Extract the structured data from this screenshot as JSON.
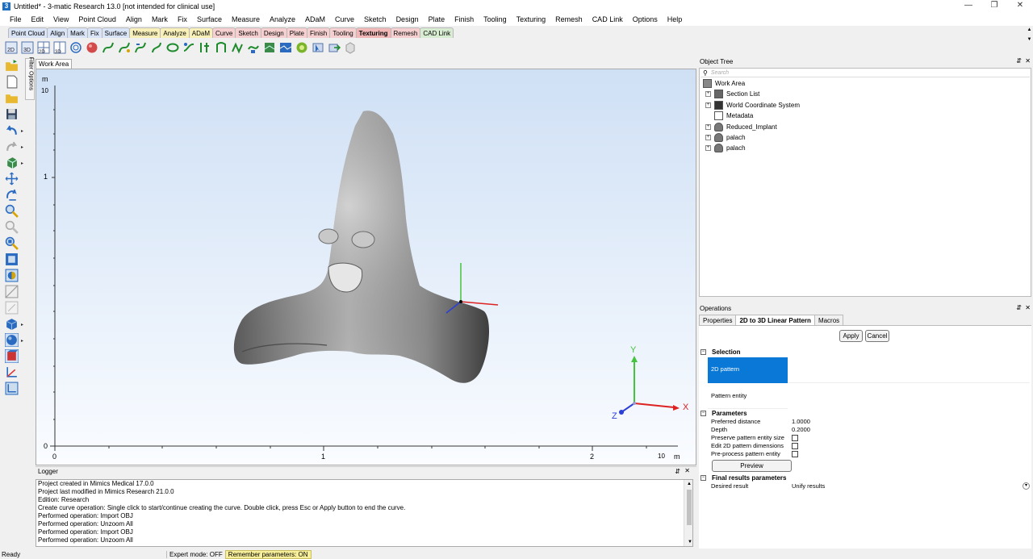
{
  "window": {
    "title": "Untitled* - 3-matic Research 13.0  [not intended for clinical use]",
    "app_icon": "3"
  },
  "menu": [
    "File",
    "Edit",
    "View",
    "Point Cloud",
    "Align",
    "Mark",
    "Fix",
    "Surface",
    "Measure",
    "Analyze",
    "ADaM",
    "Curve",
    "Sketch",
    "Design",
    "Plate",
    "Finish",
    "Tooling",
    "Texturing",
    "Remesh",
    "CAD Link",
    "Options",
    "Help"
  ],
  "tabs": [
    {
      "label": "Point Cloud",
      "color": "#d9e4f7"
    },
    {
      "label": "Align",
      "color": "#d9e4f7"
    },
    {
      "label": "Mark",
      "color": "#d9e4f7"
    },
    {
      "label": "Fix",
      "color": "#d9e4f7"
    },
    {
      "label": "Surface",
      "color": "#d9e4f7"
    },
    {
      "label": "Measure",
      "color": "#f8f0b8"
    },
    {
      "label": "Analyze",
      "color": "#f8f0b8"
    },
    {
      "label": "ADaM",
      "color": "#f8f0b8"
    },
    {
      "label": "Curve",
      "color": "#f6d0d0"
    },
    {
      "label": "Sketch",
      "color": "#f6d0d0"
    },
    {
      "label": "Design",
      "color": "#f6d0d0"
    },
    {
      "label": "Plate",
      "color": "#f6d0d0"
    },
    {
      "label": "Finish",
      "color": "#f6d0d0"
    },
    {
      "label": "Tooling",
      "color": "#f6d0d0"
    },
    {
      "label": "Texturing",
      "color": "#f2b8b8"
    },
    {
      "label": "Remesh",
      "color": "#f6d0d0"
    },
    {
      "label": "CAD Link",
      "color": "#d8ecd2"
    }
  ],
  "viewport": {
    "tab_label": "Work Area",
    "y_unit": "m",
    "y_ticks": [
      "10",
      "1",
      "0"
    ],
    "x_ticks": [
      "0",
      "1",
      "2",
      "10"
    ],
    "x_unit": "m",
    "axis_labels": {
      "x": "X",
      "y": "Y",
      "z": "Z"
    }
  },
  "side_label": "Filter Options",
  "object_tree": {
    "title": "Object Tree",
    "search_placeholder": "Search",
    "items": [
      {
        "label": "Work Area",
        "icon": "work-area-icon"
      },
      {
        "label": "Section List",
        "icon": "section-list-icon"
      },
      {
        "label": "World Coordinate System",
        "icon": "coordinate-system-icon"
      },
      {
        "label": "Metadata",
        "icon": "metadata-icon"
      },
      {
        "label": "Reduced_Implant",
        "icon": "part-icon"
      },
      {
        "label": "palach",
        "icon": "part-icon"
      },
      {
        "label": "palach",
        "icon": "part-icon"
      }
    ]
  },
  "operations": {
    "title": "Operations",
    "tabs": [
      "Properties",
      "2D to 3D Linear Pattern",
      "Macros"
    ],
    "apply": "Apply",
    "cancel": "Cancel",
    "selection": {
      "title": "Selection",
      "pattern_2d": "2D pattern",
      "pattern_entity": "Pattern entity"
    },
    "parameters": {
      "title": "Parameters",
      "preferred_distance_label": "Preferred distance",
      "preferred_distance": "1.0000",
      "depth_label": "Depth",
      "depth": "0.2000",
      "preserve_label": "Preserve pattern entity size",
      "edit_label": "Edit 2D pattern dimensions",
      "preprocess_label": "Pre-process pattern entity",
      "preview": "Preview"
    },
    "final": {
      "title": "Final results parameters",
      "desired_label": "Desired result",
      "desired": "Unify results"
    }
  },
  "logger": {
    "title": "Logger",
    "lines": [
      "Project created in Mimics Medical 17.0.0",
      "Project last modified in Mimics Research 21.0.0",
      "Edition: Research",
      "Create curve operation: Single click to start/continue creating the curve. Double click, press Esc or Apply button to end the curve.",
      "Performed operation: Import OBJ",
      "Performed operation: Unzoom All",
      "Performed operation: Import OBJ",
      "Performed operation: Unzoom All"
    ]
  },
  "status": {
    "ready": "Ready",
    "expert": "Expert mode: OFF",
    "remember": "Remember parameters: ON"
  }
}
